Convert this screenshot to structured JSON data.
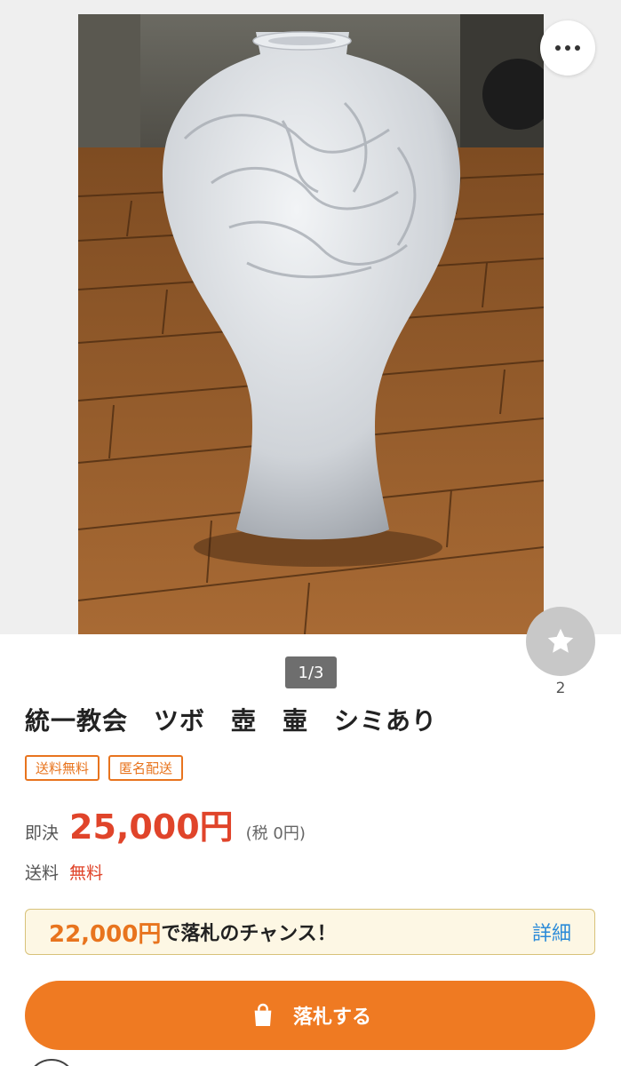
{
  "image": {
    "counter": "1/3",
    "more_icon": "more-horizontal-icon",
    "watch_icon": "star-icon",
    "watch_count": "2"
  },
  "listing": {
    "title": "統一教会　ツボ　壺　壷　シミあり",
    "tags": [
      "送料無料",
      "匿名配送"
    ],
    "price_label": "即決",
    "price_value": "25,000円",
    "price_tax": "(税 0円)",
    "shipping_label": "送料",
    "shipping_value": "無料"
  },
  "chance": {
    "price": "22,000円",
    "text": "で落札のチャンス！",
    "detail_link": "詳細"
  },
  "bid_button": {
    "label": "落札する",
    "icon": "shopping-bag-icon"
  },
  "colors": {
    "accent_orange": "#ef7a22",
    "price_red": "#e0442a",
    "link_blue": "#2a8ad8"
  }
}
